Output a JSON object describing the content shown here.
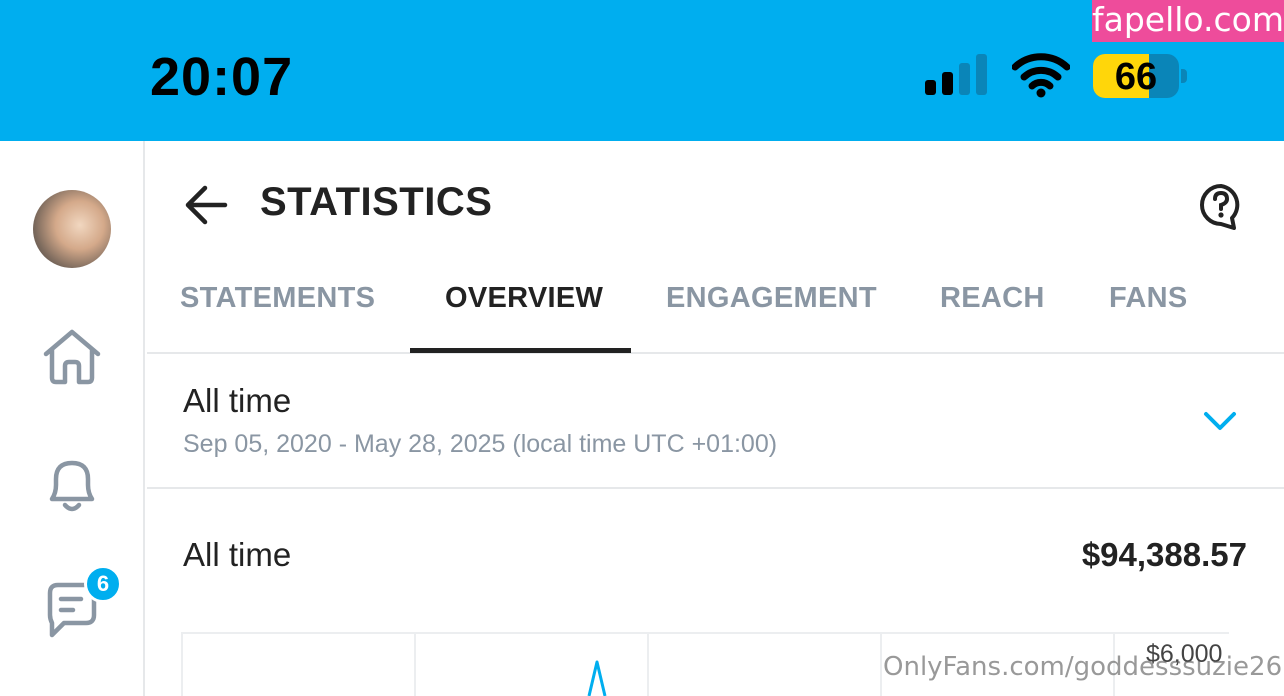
{
  "status_bar": {
    "time": "20:07",
    "battery_level": "66",
    "signal_bars_active": 2,
    "signal_bars_total": 4,
    "wifi_icon": "wifi-icon",
    "background_color": "#00aeef",
    "battery_fill_color": "#ffd60a"
  },
  "watermark_top": "fapello.com",
  "sidebar": {
    "notification_badge": "6",
    "icons": [
      "home-icon",
      "bell-icon",
      "message-icon"
    ]
  },
  "header": {
    "title": "STATISTICS",
    "back_icon": "arrow-left-icon",
    "help_icon": "help-icon"
  },
  "tabs": [
    {
      "label": "STATEMENTS",
      "active": false
    },
    {
      "label": "OVERVIEW",
      "active": true
    },
    {
      "label": "ENGAGEMENT",
      "active": false
    },
    {
      "label": "REACH",
      "active": false
    },
    {
      "label": "FANS",
      "active": false
    }
  ],
  "period": {
    "label": "All time",
    "range": "Sep 05, 2020 - May 28, 2025 (local time UTC +01:00)"
  },
  "summary": {
    "label": "All time",
    "total": "$94,388.57"
  },
  "chart": {
    "y_tick_label": "$6,000",
    "accent_color": "#00aeef"
  },
  "watermark_bottom": "OnlyFans.com/goddesssuzie26"
}
